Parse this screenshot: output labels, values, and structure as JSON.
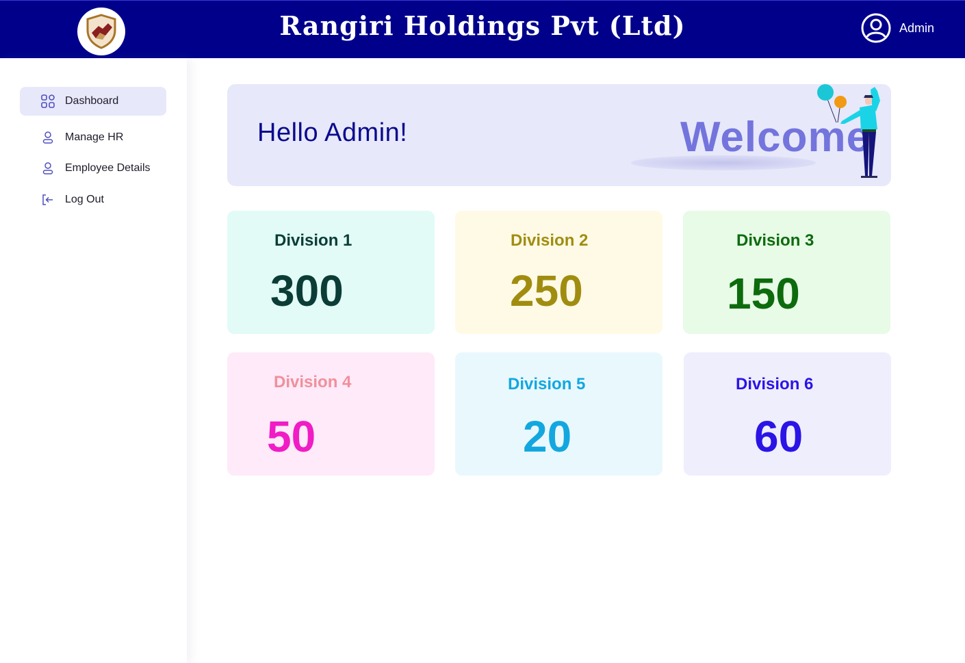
{
  "header": {
    "title": "Rangiri  Holdings Pvt (Ltd)",
    "user_label": "Admin",
    "logo_icon": "handshake-shield-logo",
    "user_icon": "user-circle-icon"
  },
  "sidebar": {
    "items": [
      {
        "label": "Dashboard",
        "icon": "grid-icon",
        "active": true
      },
      {
        "label": "Manage HR",
        "icon": "user-icon",
        "active": false
      },
      {
        "label": "Employee Details",
        "icon": "user-icon",
        "active": false
      },
      {
        "label": "Log Out",
        "icon": "logout-icon",
        "active": false
      }
    ]
  },
  "welcome": {
    "greeting": "Hello Admin!",
    "word": "Welcome"
  },
  "cards": [
    {
      "title": "Division 1",
      "value": "300",
      "bg": "#e2fbf7",
      "title_color": "#0b3d36",
      "value_color": "#0b3d36"
    },
    {
      "title": "Division 2",
      "value": "250",
      "bg": "#fffae6",
      "title_color": "#a08d10",
      "value_color": "#a08d10"
    },
    {
      "title": "Division 3",
      "value": "150",
      "bg": "#e7fbe7",
      "title_color": "#0d6b0d",
      "value_color": "#0d6b0d"
    },
    {
      "title": "Division 4",
      "value": "50",
      "bg": "#feeaf8",
      "title_color": "#f18f9c",
      "value_color": "#f01cc6"
    },
    {
      "title": "Division 5",
      "value": "20",
      "bg": "#e9f8fd",
      "title_color": "#13a7e0",
      "value_color": "#13a7e0"
    },
    {
      "title": "Division 6",
      "value": "60",
      "bg": "#efeefd",
      "title_color": "#2b14e6",
      "value_color": "#2b14e6"
    }
  ],
  "colors": {
    "header_bg": "#00008b",
    "accent": "#0a0a8c",
    "active_nav_bg": "#e8e8fb"
  }
}
